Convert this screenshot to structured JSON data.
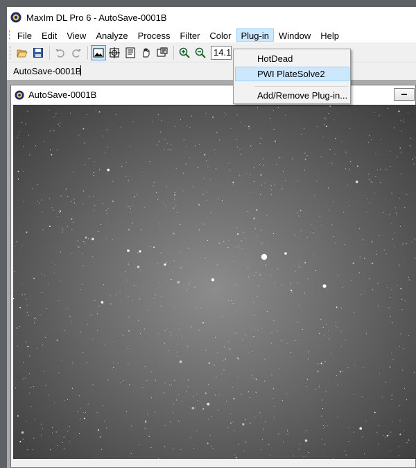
{
  "app": {
    "title": "MaxIm DL Pro 6 - AutoSave-0001B",
    "icon": "maxim-app-icon"
  },
  "menu": {
    "items": [
      "File",
      "Edit",
      "View",
      "Analyze",
      "Process",
      "Filter",
      "Color",
      "Plug-in",
      "Window",
      "Help"
    ],
    "active": "Plug-in"
  },
  "toolbar": {
    "buttons": [
      "open-icon",
      "save-icon",
      "undo-icon",
      "redo-icon",
      "image-view-icon",
      "crosshair-icon",
      "info-icon",
      "hand-icon",
      "screen-stretch-icon",
      "zoom-in-icon",
      "zoom-out-icon"
    ],
    "zoom_value": "14.1"
  },
  "document_selector": {
    "value": "AutoSave-0001B"
  },
  "image_window": {
    "title": "AutoSave-0001B",
    "content": "star-field-image"
  },
  "plugin_menu": {
    "items": [
      {
        "label": "HotDead"
      },
      {
        "label": "PWI PlateSolve2",
        "highlighted": true
      },
      {
        "label": "Add/Remove Plug-in..."
      }
    ],
    "highlight_color": "#cce8ff"
  }
}
